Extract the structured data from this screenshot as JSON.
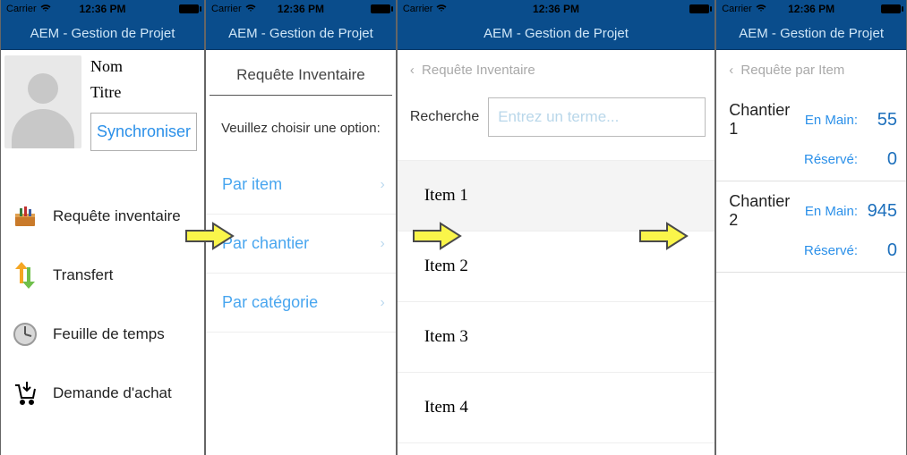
{
  "statusbar": {
    "carrier": "Carrier",
    "time": "12:36 PM"
  },
  "app_title": "AEM - Gestion de Projet",
  "screen1": {
    "name": "Nom",
    "title": "Titre",
    "sync": "Synchroniser",
    "menu": [
      {
        "label": "Requête inventaire"
      },
      {
        "label": "Transfert"
      },
      {
        "label": "Feuille de temps"
      },
      {
        "label": "Demande d'achat"
      }
    ]
  },
  "screen2": {
    "header": "Requête Inventaire",
    "prompt": "Veuillez choisir une option:",
    "options": [
      {
        "label": "Par item"
      },
      {
        "label": "Par chantier"
      },
      {
        "label": "Par catégorie"
      }
    ]
  },
  "screen3": {
    "back": "Requête Inventaire",
    "search_label": "Recherche",
    "search_placeholder": "Entrez un terme...",
    "items": [
      "Item 1",
      "Item 2",
      "Item 3",
      "Item 4"
    ]
  },
  "screen4": {
    "back": "Requête par Item",
    "onhand_label": "En Main:",
    "reserved_label": "Réservé:",
    "rows": [
      {
        "site": "Chantier 1",
        "onhand": "55",
        "reserved": "0"
      },
      {
        "site": "Chantier 2",
        "onhand": "945",
        "reserved": "0"
      }
    ]
  }
}
